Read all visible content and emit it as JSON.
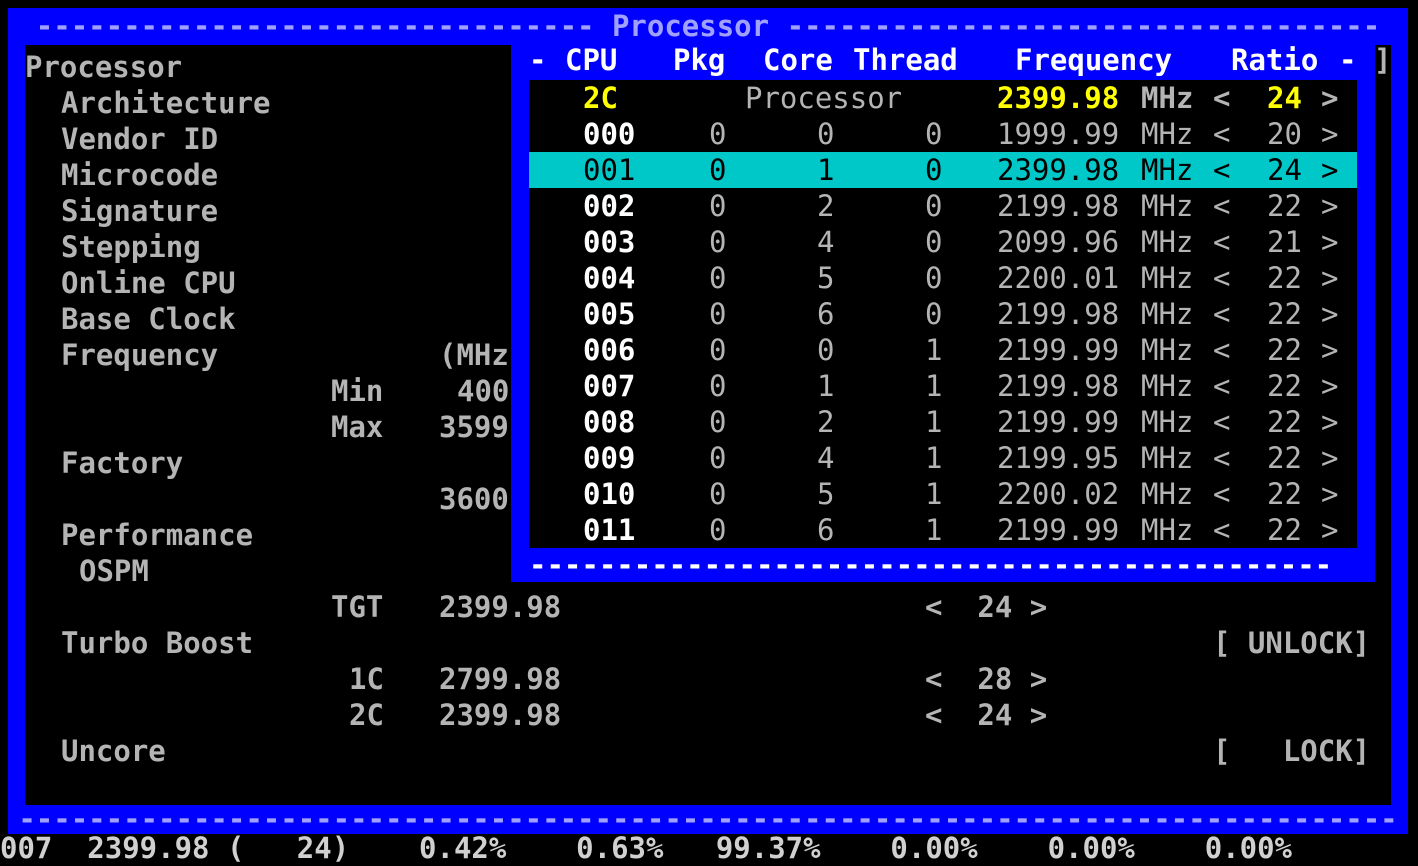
{
  "dialog": {
    "title": "Processor",
    "bottom_rule": "-------------------------------------------------------------------------------"
  },
  "info": {
    "processor": "Processor",
    "architecture": "Architecture",
    "vendor_id": "Vendor ID",
    "microcode": "Microcode",
    "signature": "Signature",
    "stepping": "Stepping",
    "online_cpu": "Online CPU",
    "base_clock": "Base Clock",
    "frequency": "Frequency",
    "freq_unit": "(MHz",
    "min_label": "Min",
    "min_value": "400",
    "max_label": "Max",
    "max_value": "3599",
    "factory": "Factory",
    "factory_value": "3600",
    "performance": "Performance",
    "ospm": "OSPM",
    "tgt_label": "TGT",
    "tgt_value": "2399.98",
    "tgt_ratio": "<  24 >",
    "turbo_boost": "Turbo Boost",
    "turbo_lock": "[ UNLOCK]",
    "c1_label": "1C",
    "c1_value": "2799.98",
    "c1_ratio": "<  28 >",
    "c2_label": "2C",
    "c2_value": "2399.98",
    "c2_ratio": "<  24 >",
    "uncore": "Uncore",
    "uncore_lock": "[   LOCK]"
  },
  "popup": {
    "headers": {
      "lead": "-",
      "cpu": "CPU",
      "pkg": "Pkg",
      "core": "Core",
      "thread": "Thread",
      "frequency": "Frequency",
      "ratio": "Ratio",
      "trail": "-"
    },
    "top_row": {
      "cpu": "2C",
      "label": "Processor",
      "freq": "2399.98",
      "unit": "MHz",
      "lt": "<",
      "ratio": "24",
      "gt": ">"
    },
    "rows": [
      {
        "cpu": "000",
        "pkg": "0",
        "core": "0",
        "thread": "0",
        "freq": "1999.99",
        "unit": "MHz",
        "ratio": "20"
      },
      {
        "cpu": "001",
        "pkg": "0",
        "core": "1",
        "thread": "0",
        "freq": "2399.98",
        "unit": "MHz",
        "ratio": "24"
      },
      {
        "cpu": "002",
        "pkg": "0",
        "core": "2",
        "thread": "0",
        "freq": "2199.98",
        "unit": "MHz",
        "ratio": "22"
      },
      {
        "cpu": "003",
        "pkg": "0",
        "core": "4",
        "thread": "0",
        "freq": "2099.96",
        "unit": "MHz",
        "ratio": "21"
      },
      {
        "cpu": "004",
        "pkg": "0",
        "core": "5",
        "thread": "0",
        "freq": "2200.01",
        "unit": "MHz",
        "ratio": "22"
      },
      {
        "cpu": "005",
        "pkg": "0",
        "core": "6",
        "thread": "0",
        "freq": "2199.98",
        "unit": "MHz",
        "ratio": "22"
      },
      {
        "cpu": "006",
        "pkg": "0",
        "core": "0",
        "thread": "1",
        "freq": "2199.99",
        "unit": "MHz",
        "ratio": "22"
      },
      {
        "cpu": "007",
        "pkg": "0",
        "core": "1",
        "thread": "1",
        "freq": "2199.98",
        "unit": "MHz",
        "ratio": "22"
      },
      {
        "cpu": "008",
        "pkg": "0",
        "core": "2",
        "thread": "1",
        "freq": "2199.99",
        "unit": "MHz",
        "ratio": "22"
      },
      {
        "cpu": "009",
        "pkg": "0",
        "core": "4",
        "thread": "1",
        "freq": "2199.95",
        "unit": "MHz",
        "ratio": "22"
      },
      {
        "cpu": "010",
        "pkg": "0",
        "core": "5",
        "thread": "1",
        "freq": "2200.02",
        "unit": "MHz",
        "ratio": "22"
      },
      {
        "cpu": "011",
        "pkg": "0",
        "core": "6",
        "thread": "1",
        "freq": "2199.99",
        "unit": "MHz",
        "ratio": "22"
      }
    ],
    "selected_cpu": "001",
    "lt": "<",
    "gt": ">",
    "bottom_rule": "----------------------------------------------",
    "right_bracket": "]"
  },
  "background_status": "007  2399.98 (   24)    0.42%    0.63%   99.37%    0.00%    0.00%    0.00%",
  "colors": {
    "dialog_blue": "#0000ff",
    "selection": "#00c8c8",
    "highlight_yellow": "#ffff00",
    "text_grey": "#b4b4b4"
  }
}
